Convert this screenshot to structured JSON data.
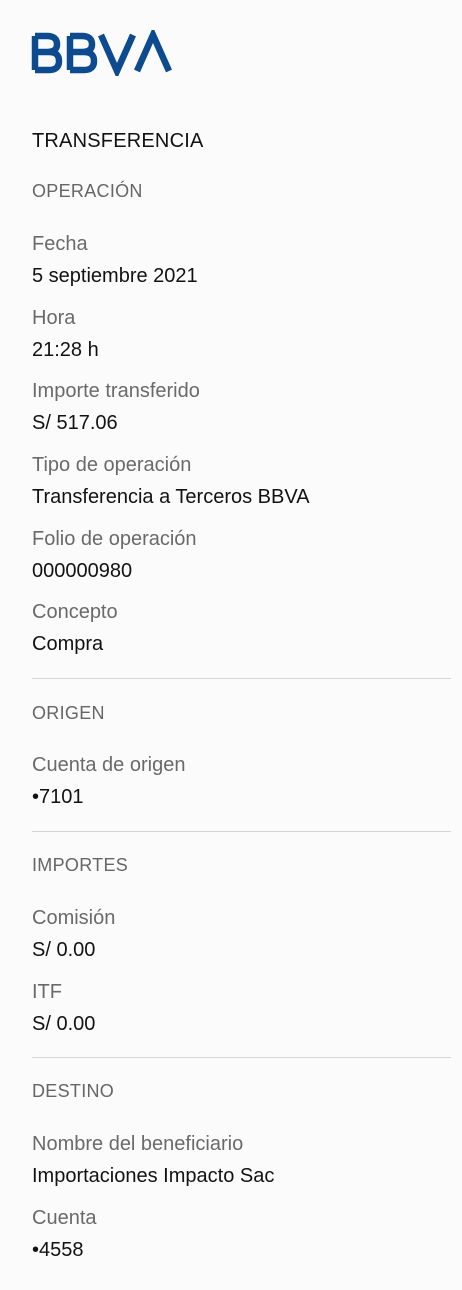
{
  "brand": {
    "logo_text": "BBVA",
    "color": "#0c4b8f"
  },
  "page_title": "TRANSFERENCIA",
  "sections": {
    "operacion": {
      "title": "OPERACIÓN",
      "fields": [
        {
          "label": "Fecha",
          "value": "5 septiembre 2021"
        },
        {
          "label": "Hora",
          "value": "21:28 h"
        },
        {
          "label": "Importe transferido",
          "value": "S/ 517.06"
        },
        {
          "label": "Tipo de operación",
          "value": "Transferencia a Terceros BBVA"
        },
        {
          "label": "Folio de operación",
          "value": "000000980"
        },
        {
          "label": "Concepto",
          "value": "Compra"
        }
      ]
    },
    "origen": {
      "title": "ORIGEN",
      "fields": [
        {
          "label": "Cuenta de origen",
          "value": "•7101"
        }
      ]
    },
    "importes": {
      "title": "IMPORTES",
      "fields": [
        {
          "label": "Comisión",
          "value": "S/ 0.00"
        },
        {
          "label": "ITF",
          "value": "S/ 0.00"
        }
      ]
    },
    "destino": {
      "title": "DESTINO",
      "fields": [
        {
          "label": "Nombre del beneficiario",
          "value": "Importaciones Impacto Sac"
        },
        {
          "label": "Cuenta",
          "value": "•4558"
        }
      ]
    }
  }
}
